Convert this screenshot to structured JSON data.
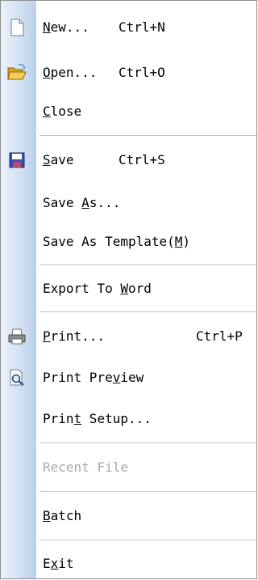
{
  "menu": {
    "items": [
      {
        "id": "new",
        "pre": "",
        "u": "N",
        "post": "ew...",
        "shortcut": "Ctrl+N",
        "icon": "new-document-icon"
      },
      {
        "id": "open",
        "pre": "",
        "u": "O",
        "post": "pen...",
        "shortcut": "Ctrl+O",
        "icon": "open-folder-icon"
      },
      {
        "id": "close",
        "pre": "",
        "u": "C",
        "post": "lose",
        "shortcut": ""
      },
      {
        "id": "save",
        "pre": "",
        "u": "S",
        "post": "ave",
        "shortcut": "Ctrl+S",
        "icon": "save-floppy-icon"
      },
      {
        "id": "save-as",
        "pre": "Save ",
        "u": "A",
        "post": "s...",
        "shortcut": ""
      },
      {
        "id": "save-as-template",
        "pre": "Save As Template(",
        "u": "M",
        "post": ")",
        "shortcut": ""
      },
      {
        "id": "export-to-word",
        "pre": "Export To ",
        "u": "W",
        "post": "ord",
        "shortcut": ""
      },
      {
        "id": "print",
        "pre": "",
        "u": "P",
        "post": "rint...",
        "shortcut": "Ctrl+P",
        "icon": "printer-icon"
      },
      {
        "id": "print-preview",
        "pre": "Print Pre",
        "u": "v",
        "post": "iew",
        "shortcut": "",
        "icon": "print-preview-icon"
      },
      {
        "id": "print-setup",
        "pre": "Prin",
        "u": "t",
        "post": " Setup...",
        "shortcut": ""
      },
      {
        "id": "recent-file",
        "pre": "Recent File",
        "u": "",
        "post": "",
        "shortcut": "",
        "disabled": true
      },
      {
        "id": "batch",
        "pre": "",
        "u": "B",
        "post": "atch",
        "shortcut": ""
      },
      {
        "id": "exit",
        "pre": "E",
        "u": "x",
        "post": "it",
        "shortcut": ""
      }
    ]
  },
  "colors": {
    "gutter_light": "#eaf1fa",
    "gutter_dark": "#bcd0ea",
    "separator": "#c5c5c5",
    "disabled_text": "#a9a9a9"
  }
}
